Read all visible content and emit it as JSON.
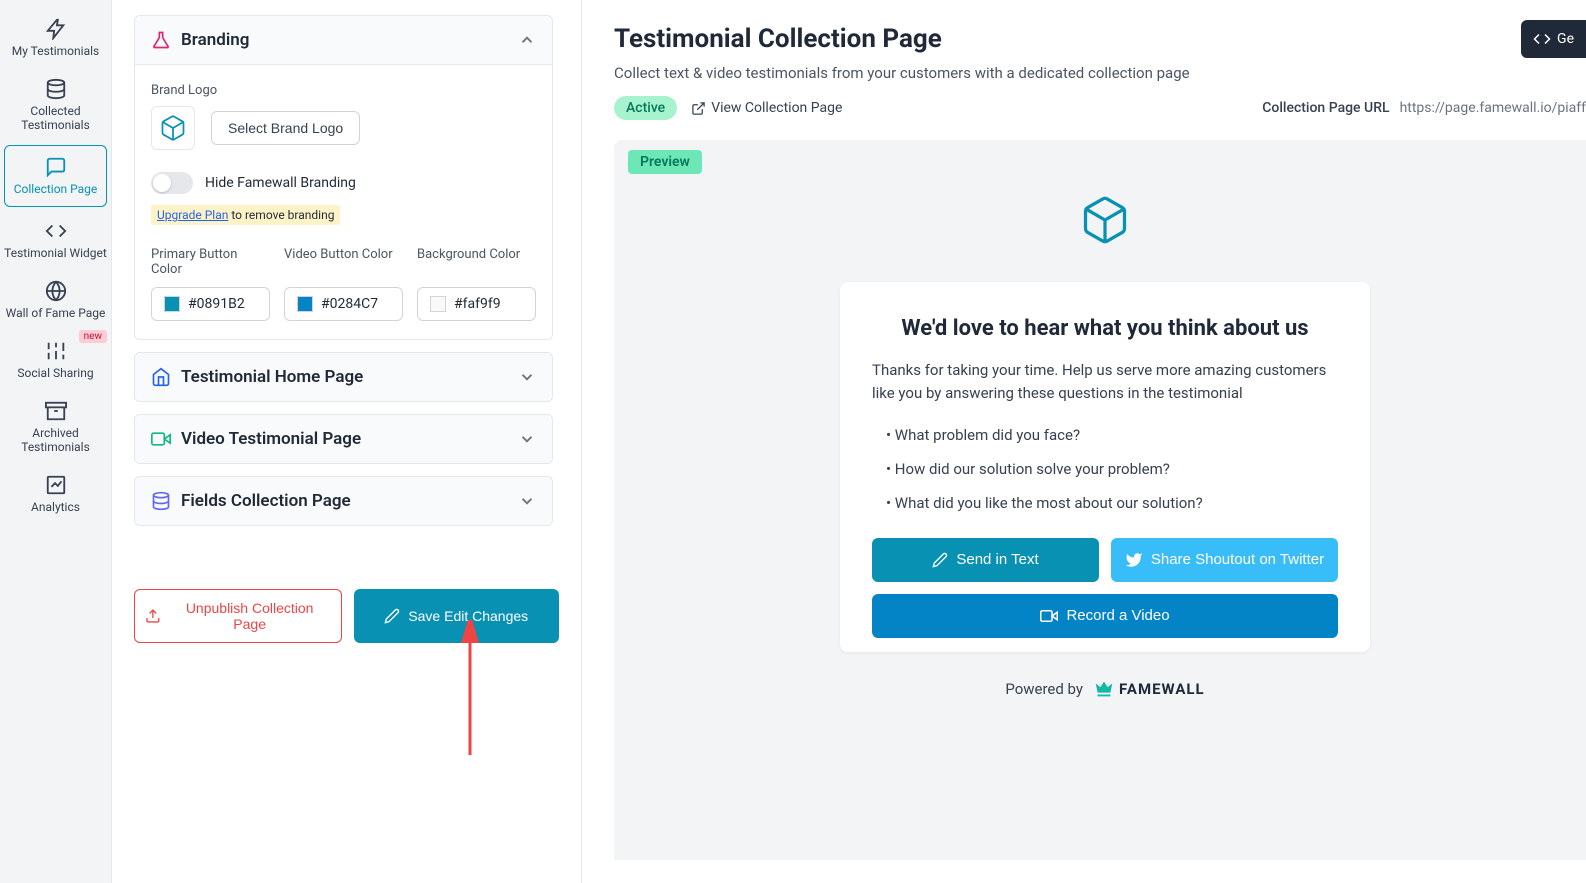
{
  "sidebar": {
    "items": [
      {
        "label": "My Testimonials"
      },
      {
        "label": "Collected Testimonials"
      },
      {
        "label": "Collection Page"
      },
      {
        "label": "Testimonial Widget"
      },
      {
        "label": "Wall of Fame Page"
      },
      {
        "label": "Social Sharing",
        "badge": "new"
      },
      {
        "label": "Archived Testimonials"
      },
      {
        "label": "Analytics"
      }
    ]
  },
  "editor": {
    "branding": {
      "title": "Branding",
      "brandLogoLabel": "Brand Logo",
      "selectLogo": "Select Brand Logo",
      "hideBranding": "Hide Famewall Branding",
      "upgradeLink": "Upgrade Plan",
      "upgradeRest": " to remove branding",
      "primaryBtnLabel": "Primary Button Color",
      "primaryBtnValue": "#0891B2",
      "videoBtnLabel": "Video Button Color",
      "videoBtnValue": "#0284C7",
      "bgLabel": "Background Color",
      "bgValue": "#faf9f9"
    },
    "accordions": [
      {
        "title": "Testimonial Home Page"
      },
      {
        "title": "Video Testimonial Page"
      },
      {
        "title": "Fields Collection Page"
      }
    ],
    "unpublish": "Unpublish Collection Page",
    "save": "Save Edit Changes"
  },
  "main": {
    "title": "Testimonial Collection Page",
    "subtitle": "Collect text & video testimonials from your customers with a dedicated collection page",
    "status": "Active",
    "viewLink": "View Collection Page",
    "urlLabel": "Collection Page URL",
    "url": "https://page.famewall.io/piaff",
    "getCode": "Ge",
    "previewTag": "Preview",
    "card": {
      "title": "We'd love to hear what you think about us",
      "sub": "Thanks for taking your time. Help us serve more amazing customers like you by answering these questions in the testimonial",
      "q1": "What problem did you face?",
      "q2": "How did our solution solve your problem?",
      "q3": "What did you like the most about our solution?",
      "sendText": "Send in Text",
      "shareTw": "Share Shoutout on Twitter",
      "recordVid": "Record a Video"
    },
    "poweredBy": "Powered by",
    "brand": "FAMEWALL"
  }
}
